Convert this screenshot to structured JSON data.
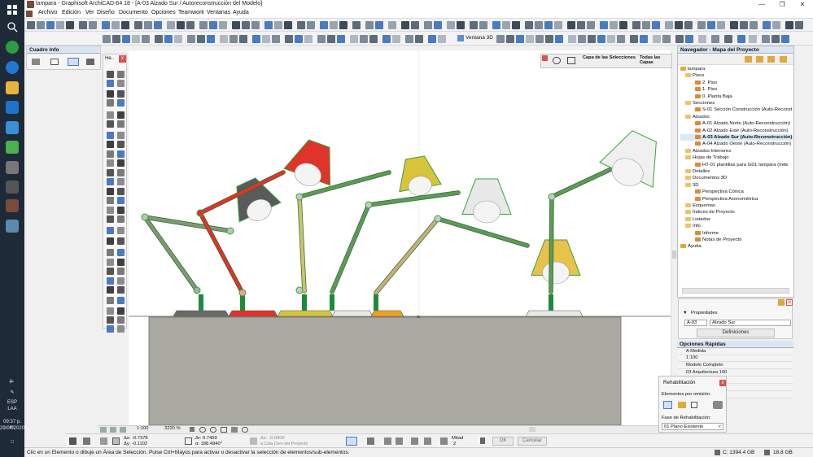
{
  "titlebar": {
    "title": "lampara - Graphisoft ArchiCAD-64 18 - [A-03 Alzado Sur / Autoreconstrucción del Modelo]"
  },
  "window_controls": {
    "minimize": "—",
    "restore": "❐",
    "close": "✕"
  },
  "menu": [
    "Archivo",
    "Edición",
    "Ver",
    "Diseño",
    "Documento",
    "Opciones",
    "Teamwork",
    "Ventanas",
    "Ayuda"
  ],
  "toolbar2": {
    "view3d_label": "Ventana 3D"
  },
  "infobox": {
    "title": "Cuadro Info"
  },
  "toolbox": {
    "title": "He..",
    "close": "x"
  },
  "layers_panel": {
    "capa_label": "Capa de las Selecciones",
    "todas_label": "Todas las Capas"
  },
  "navigator": {
    "title": "Navegador - Mapa del Proyecto",
    "tree": [
      {
        "label": "lampara",
        "depth": 0
      },
      {
        "label": "Pisos",
        "depth": 1
      },
      {
        "label": "2. Piso",
        "depth": 3
      },
      {
        "label": "1. Piso",
        "depth": 3
      },
      {
        "label": "0. Planta Baja",
        "depth": 3
      },
      {
        "label": "Secciones",
        "depth": 1
      },
      {
        "label": "S-01 Sección Construcción (Auto-Reconst",
        "depth": 3
      },
      {
        "label": "Alzados",
        "depth": 1
      },
      {
        "label": "A-01 Alzado Norte (Auto-Reconstrucción)",
        "depth": 3
      },
      {
        "label": "A-02 Alzado Este (Auto-Reconstrucción)",
        "depth": 3
      },
      {
        "label": "A-03 Alzado Sur (Auto-Reconstrucción)",
        "depth": 3,
        "selected": true
      },
      {
        "label": "A-04 Alzado Oeste (Auto-Reconstrucción)",
        "depth": 3
      },
      {
        "label": "Alzados Interiores",
        "depth": 1
      },
      {
        "label": "Hojas de Trabajo",
        "depth": 1
      },
      {
        "label": "HT-01 plantillas para GDL lampara (Inde",
        "depth": 3
      },
      {
        "label": "Detalles",
        "depth": 1
      },
      {
        "label": "Documentos 3D",
        "depth": 1
      },
      {
        "label": "3D",
        "depth": 1
      },
      {
        "label": "Perspectiva Cónica",
        "depth": 3
      },
      {
        "label": "Perspectiva Axonométrica",
        "depth": 3
      },
      {
        "label": "Esquemas",
        "depth": 1
      },
      {
        "label": "Índices de Proyecto",
        "depth": 1
      },
      {
        "label": "Listados",
        "depth": 1
      },
      {
        "label": "Info.",
        "depth": 1
      },
      {
        "label": "Informe",
        "depth": 3
      },
      {
        "label": "Notas de Proyecto",
        "depth": 3
      },
      {
        "label": "Ayuda",
        "depth": 0
      }
    ]
  },
  "properties": {
    "title": "Propiedades",
    "id_value": "A-03",
    "name_value": "Alzado Sur",
    "definitions_button": "Definiciones"
  },
  "quick_options": {
    "title": "Opciones Rápidas",
    "rows": [
      "A Medida",
      "1:100",
      "Modelo Completo",
      "03 Arquitectura 100"
    ]
  },
  "rehab": {
    "title": "Rehabilitación",
    "defaults_label": "Elementos por omisión:",
    "phase_label": "Fase de Rehabilitación:",
    "phase_value": "01 Plano Existente",
    "close": "x"
  },
  "canvas_bar": {
    "scale": "1:100",
    "zoom": "3220 %"
  },
  "coords": {
    "dx": "Δx: -0.7378",
    "dy": "Δy: -0.1102",
    "dr": "Δr: 0.7459",
    "da": "α: 188.4940°",
    "dz": "Δz: -0.0000",
    "dz_ref": "a Cota Cero del Proyecto",
    "mitad": "Mitad",
    "mitad_n": "2",
    "ok": "OK",
    "cancel": "Cancelar"
  },
  "status": {
    "message": "Clic en un Elemento o dibuje un Área de Selección. Pulse Ctrl+Mayús para activar o desactivar la selección de elementos/sub-elementos.",
    "disk": "C: 1394.4 GB",
    "ram": "18.8 GB"
  },
  "taskbar": {
    "lang1": "ESP",
    "lang2": "LAA",
    "time": "09:37 p. m.",
    "date": "29/04/2020"
  },
  "colors": {
    "lamp_dark": "#5a5a5a",
    "lamp_red": "#e0332a",
    "lamp_yellow": "#d8c43a",
    "lamp_white": "#e8e8e8",
    "lamp_orange": "#f0a020",
    "arm_green": "#5f9a56",
    "floor": "#a9a9a2",
    "edge_green": "#3aa040"
  }
}
